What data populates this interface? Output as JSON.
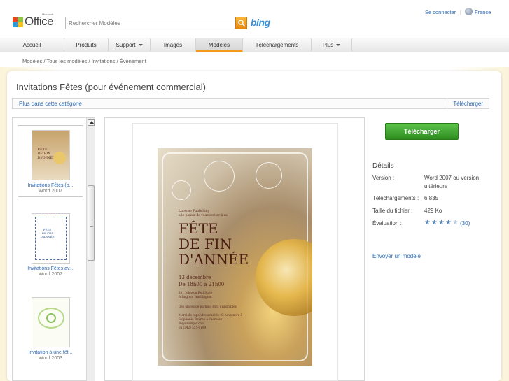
{
  "header": {
    "logo_text": "Office",
    "logo_brand": "Microsoft",
    "search_placeholder": "Rechercher Modèles",
    "bing_label": "bing",
    "signin": "Se connecter",
    "separator": "|",
    "country": "France"
  },
  "nav": {
    "items": [
      {
        "label": "Accueil",
        "dropdown": false
      },
      {
        "label": "Produits",
        "dropdown": false
      },
      {
        "label": "Support",
        "dropdown": true
      },
      {
        "label": "Images",
        "dropdown": false
      },
      {
        "label": "Modèles",
        "dropdown": false,
        "active": true
      },
      {
        "label": "Téléchargements",
        "dropdown": false
      },
      {
        "label": "Plus",
        "dropdown": true
      }
    ],
    "accent_color": "#f39a1d"
  },
  "breadcrumb": [
    "Modèles",
    "Tous les modèles",
    "Invitations",
    "Événement"
  ],
  "page_title": "Invitations Fêtes (pour événement commercial)",
  "category_bar": {
    "more_link": "Plus dans cette catégorie",
    "download_link": "Télécharger"
  },
  "template_list": [
    {
      "name": "Invitations Fêtes (p...",
      "version": "Word 2007",
      "selected": true
    },
    {
      "name": "Invitations Fêtes av...",
      "version": "Word 2007",
      "selected": false
    },
    {
      "name": "Invitation à une fêt...",
      "version": "Word 2003",
      "selected": false
    }
  ],
  "poster": {
    "org": "Lucerne Publishing",
    "invite_line": "a le plaisir de vous inviter à sa",
    "title_1": "FÊTE",
    "title_2": "DE FIN",
    "title_3": "D'ANNÉE",
    "date": "13 décembre",
    "time": "De 18h00 à 21h00",
    "address_1": "201 Johnson Rod Suite",
    "address_2": "Arlington, Washington",
    "parking": "Des places de parking sont disponibles",
    "rsvp_1": "Merci de répondre avant le 23 novembre à",
    "rsvp_2": "Stéphanie Bourne à l'adresse",
    "email": "sb@example.com",
    "phone": "ou (242) 555-0199"
  },
  "actions": {
    "download_button": "Télécharger",
    "download_color": "#3ea52d"
  },
  "details": {
    "title": "Détails",
    "version_label": "Version :",
    "version_value_1": "Word 2007 ou version",
    "version_value_2": "ultérieure",
    "downloads_label": "Téléchargements :",
    "downloads_value": "6 835",
    "size_label": "Taille du fichier :",
    "size_value": "429 Ko",
    "rating_label": "Évaluation :",
    "rating_stars": 4.5,
    "rating_count": "(30)",
    "send_link": "Envoyer un modèle"
  }
}
